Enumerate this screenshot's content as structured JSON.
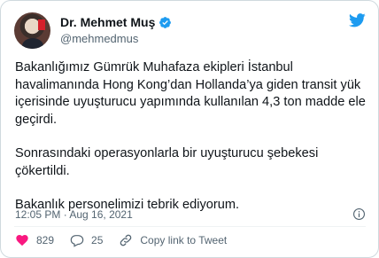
{
  "tweet": {
    "display_name": "Dr. Mehmet Muş",
    "handle": "@mehmedmus",
    "paragraphs": [
      "Bakanlığımız Gümrük Muhafaza ekipleri İstanbul havalimanında Hong Kong’dan Hollanda’ya giden transit yük içerisinde uyuşturucu yapımında kullanılan 4,3 ton madde ele geçirdi.",
      "Sonrasındaki operasyonlarla bir uyuşturucu şebekesi çökertildi.",
      "Bakanlık personelimizi tebrik ediyorum."
    ],
    "timestamp": "12:05 PM · Aug 16, 2021",
    "like_count": "829",
    "reply_count": "25",
    "share_label": "Copy link to Tweet"
  },
  "icons": {
    "verified": "verified-badge-icon",
    "twitter": "twitter-bird-icon",
    "like": "heart-icon",
    "reply": "reply-bubble-icon",
    "share": "link-icon",
    "info": "info-icon"
  },
  "colors": {
    "accent": "#1d9bf0",
    "text": "#0f1419",
    "muted": "#536471",
    "border": "#cfd9de"
  }
}
